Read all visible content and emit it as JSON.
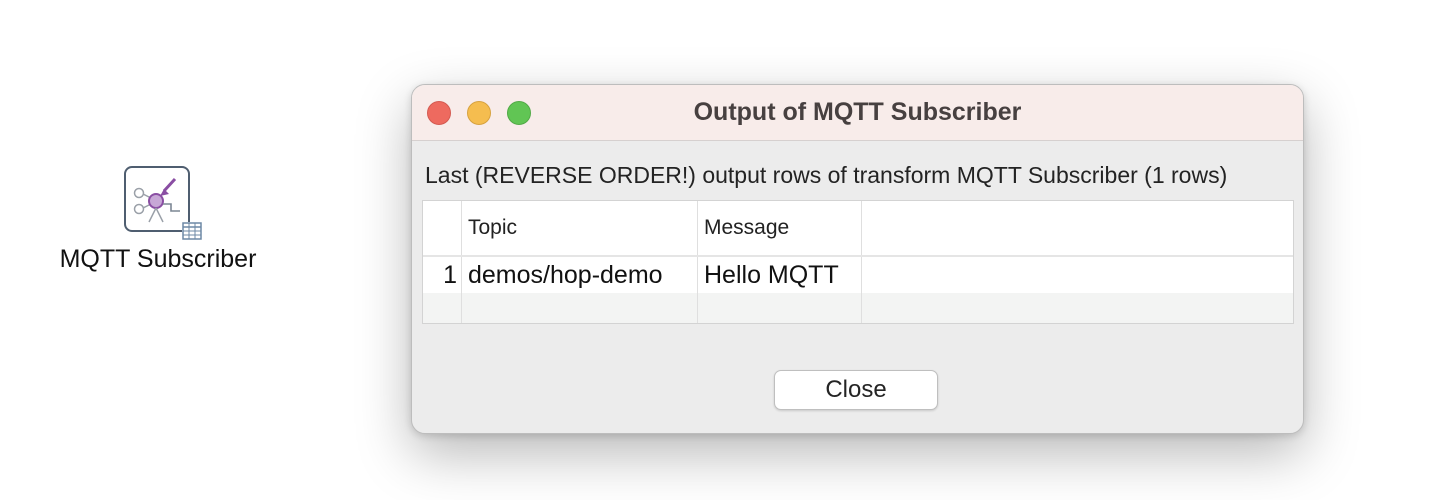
{
  "canvas": {
    "transform": {
      "label": "MQTT Subscriber",
      "icon": "mqtt-subscriber-icon",
      "badge_icon": "table-preview-icon"
    }
  },
  "dialog": {
    "title": "Output of MQTT Subscriber",
    "message": "Last (REVERSE ORDER!) output rows of transform MQTT Subscriber (1 rows)",
    "window_controls": [
      "close",
      "minimize",
      "zoom"
    ],
    "table": {
      "columns": [
        "Topic",
        "Message"
      ],
      "rows": [
        {
          "index": "1",
          "topic": "demos/hop-demo",
          "message": "Hello MQTT"
        }
      ]
    },
    "close_label": "Close"
  },
  "colors": {
    "titlebar_bg": "#f8ecea",
    "dialog_bg": "#ececec",
    "close_light": "#ee6a5f",
    "minimize_light": "#f5bd4f",
    "zoom_light": "#61c554",
    "node_border": "#4f5e70",
    "node_accent": "#8a4ea3"
  }
}
